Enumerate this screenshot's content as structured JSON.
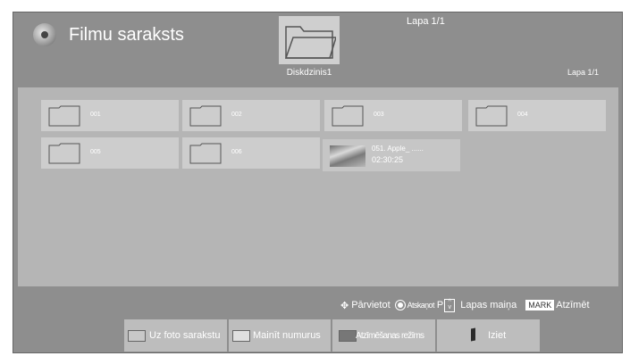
{
  "header": {
    "title": "Filmu saraksts",
    "top_page": "Lapa 1/1",
    "drive_label": "Diskdzinis1",
    "right_page": "Lapa 1/1"
  },
  "items": [
    {
      "label": "001"
    },
    {
      "label": "002"
    },
    {
      "label": "003"
    },
    {
      "label": "004"
    },
    {
      "label": "005"
    },
    {
      "label": "006"
    }
  ],
  "movie": {
    "name": "051. Apple_ ......",
    "duration": "02:30:25"
  },
  "help": {
    "move": "Pārvietot",
    "view": "Atskaņot",
    "p": "P",
    "page_change": "Lapas maiņa",
    "mark_badge": "MARK",
    "mark": "Atzīmēt"
  },
  "buttons": {
    "photo_list": "Uz foto sarakstu",
    "change_numbers": "Mainīt numurus",
    "mark_mode": "Atzīmēšanas režīms",
    "exit": "Iziet"
  },
  "colors": {
    "red": "#c8c8c8",
    "green": "#e0e0e0",
    "yellow": "#777777",
    "blue": "#2b2b2b"
  }
}
